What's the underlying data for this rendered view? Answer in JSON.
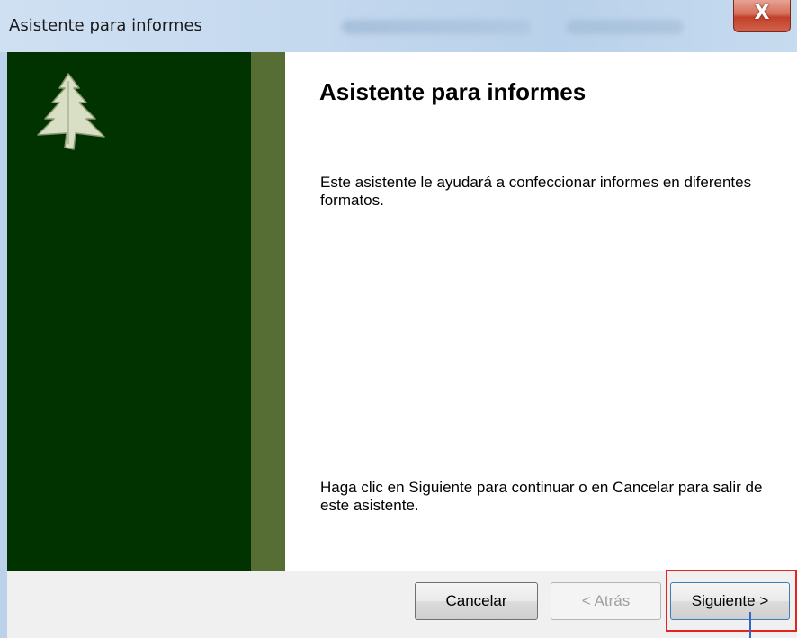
{
  "window": {
    "title": "Asistente para informes",
    "close_glyph": "X"
  },
  "sidebar": {
    "logo_icon": "tree-icon",
    "dark_color": "#013300",
    "band_color": "#566e33"
  },
  "content": {
    "heading": "Asistente para informes",
    "description": "Este asistente le ayudará a confeccionar informes en diferentes formatos.",
    "instructions": "Haga clic en Siguiente para continuar o en Cancelar para salir de este asistente."
  },
  "buttons": {
    "cancel": "Cancelar",
    "back": "< Atrás",
    "next": "Siguiente >",
    "next_mnemonic": "S",
    "next_rest": "iguiente >"
  },
  "annotation": {
    "highlight_color": "#e52420"
  }
}
